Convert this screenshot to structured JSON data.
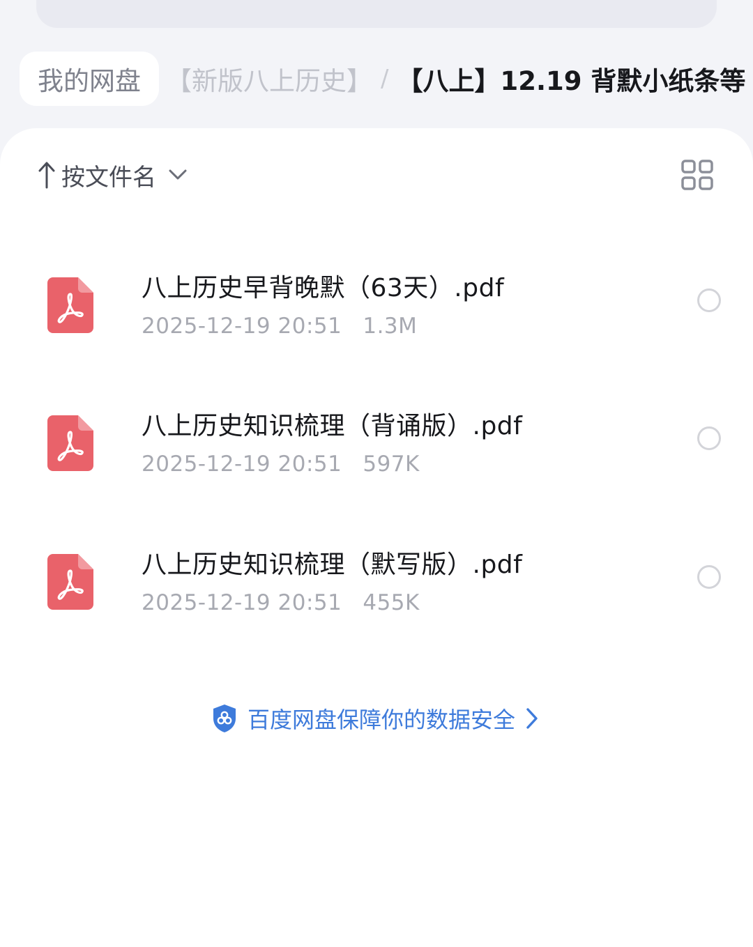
{
  "breadcrumb": {
    "root": "我的网盘",
    "parent": "【新版八上历史】",
    "separator": "/",
    "current": "【八上】12.19 背默小纸条等"
  },
  "sort": {
    "arrow_icon": "arrow-up-icon",
    "label": "按文件名",
    "dropdown_icon": "chevron-down-icon"
  },
  "view_toggle_icon": "grid-view-icon",
  "files": [
    {
      "name": "八上历史早背晚默（63天）.pdf",
      "date": "2025-12-19 20:51",
      "size": "1.3M",
      "icon": "pdf-file-icon"
    },
    {
      "name": "八上历史知识梳理（背诵版）.pdf",
      "date": "2025-12-19 20:51",
      "size": "597K",
      "icon": "pdf-file-icon"
    },
    {
      "name": "八上历史知识梳理（默写版）.pdf",
      "date": "2025-12-19 20:51",
      "size": "455K",
      "icon": "pdf-file-icon"
    }
  ],
  "safety_notice": {
    "text": "百度网盘保障你的数据安全",
    "icon": "shield-icon",
    "arrow_icon": "chevron-right-icon",
    "color": "#3e7bdb"
  },
  "colors": {
    "pdf_icon": "#e9626a",
    "background": "#f3f4f8",
    "card": "#ffffff"
  }
}
